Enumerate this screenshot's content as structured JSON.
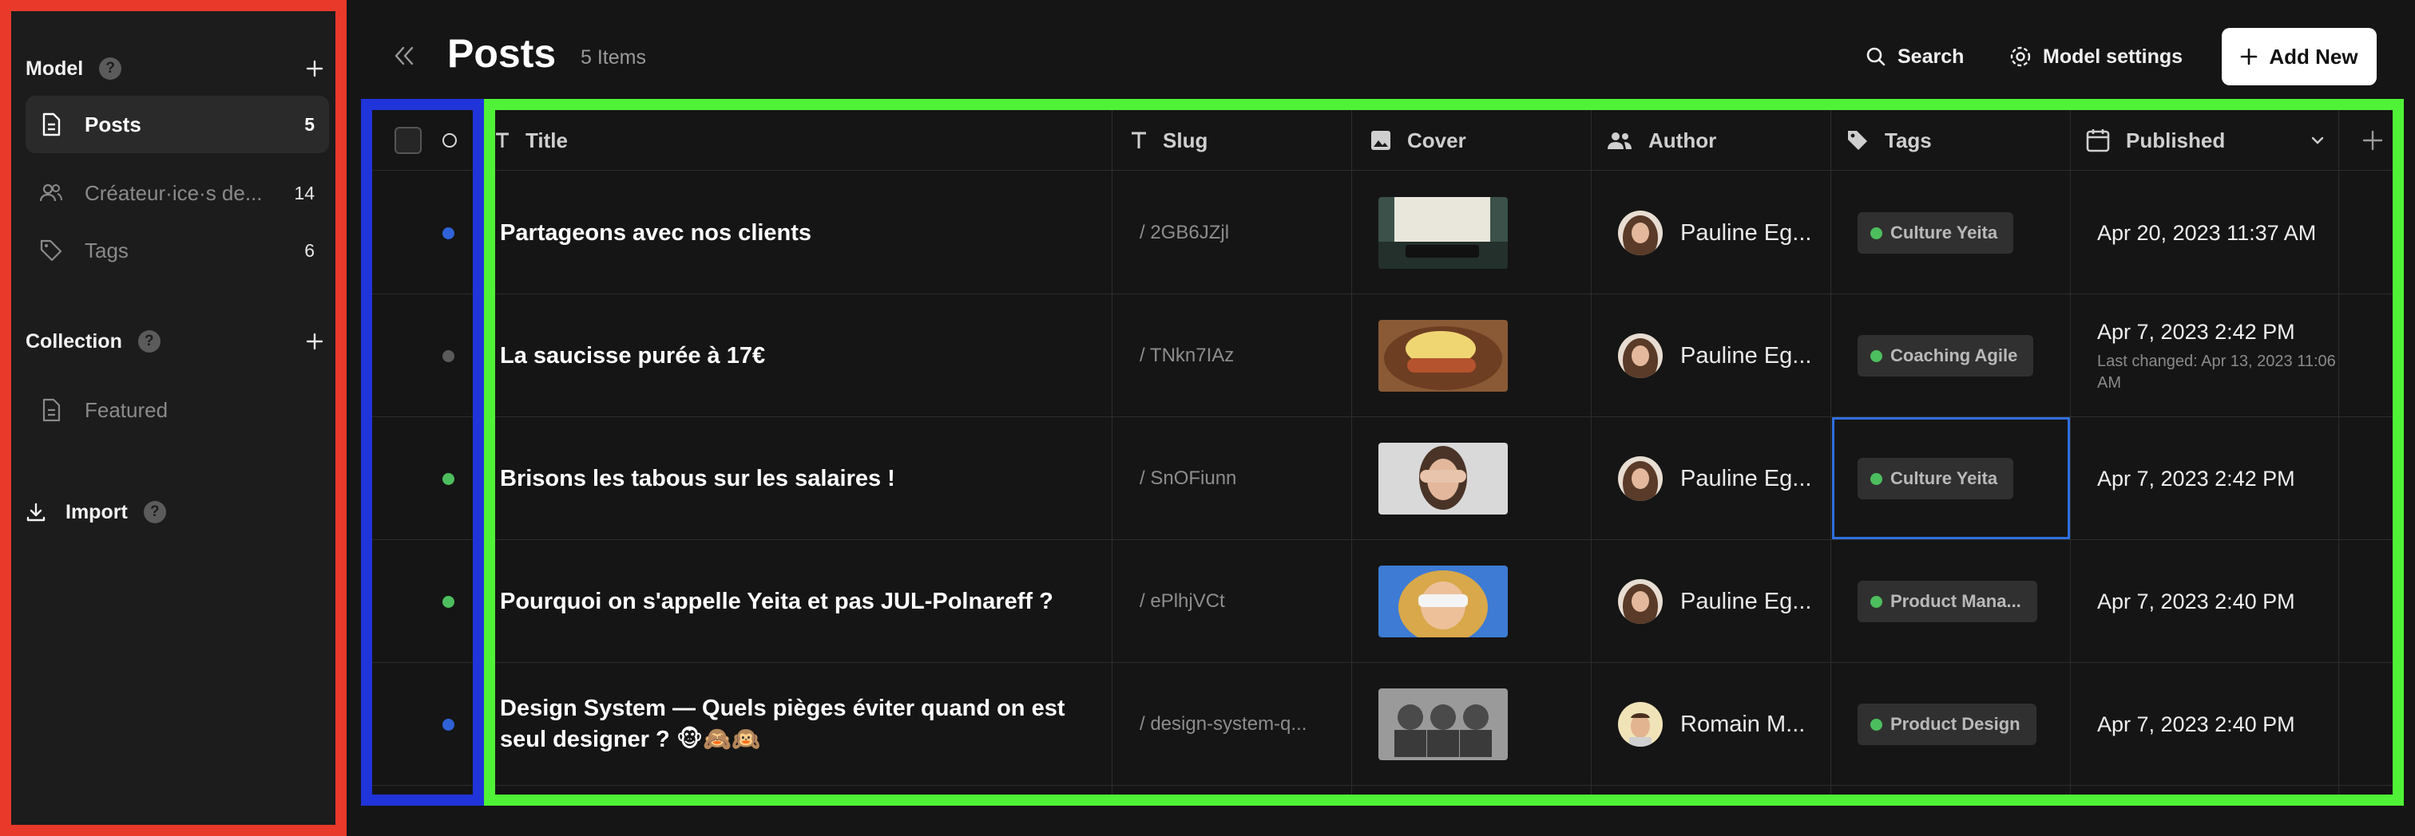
{
  "sidebar": {
    "model_label": "Model",
    "collection_label": "Collection",
    "import_label": "Import",
    "help_glyph": "?",
    "model_items": [
      {
        "label": "Posts",
        "count": "5",
        "icon": "document-icon"
      },
      {
        "label": "Créateur·ice·s de...",
        "count": "14",
        "icon": "users-icon"
      },
      {
        "label": "Tags",
        "count": "6",
        "icon": "tag-icon"
      }
    ],
    "collection_items": [
      {
        "label": "Featured",
        "icon": "document-icon"
      }
    ]
  },
  "header": {
    "title": "Posts",
    "count": "5 Items",
    "search_label": "Search",
    "settings_label": "Model settings",
    "add_label": "Add New"
  },
  "table": {
    "columns": [
      "Title",
      "Slug",
      "Cover",
      "Author",
      "Tags",
      "Published"
    ],
    "rows": [
      {
        "status_color": "#2f62d8",
        "title": "Partageons avec nos clients",
        "slug": "/ 2GB6JZjl",
        "author": "Pauline Eg...",
        "tag": "Culture Yeita",
        "published": "Apr 20, 2023 11:37 AM",
        "published_sub": ""
      },
      {
        "status_color": "#5a5a5a",
        "title": "La saucisse purée à 17€",
        "slug": "/ TNkn7IAz",
        "author": "Pauline Eg...",
        "tag": "Coaching Agile",
        "published": "Apr 7, 2023 2:42 PM",
        "published_sub": "Last changed: Apr 13, 2023 11:06 AM"
      },
      {
        "status_color": "#4dbe5e",
        "title": "Brisons les tabous sur les salaires !",
        "slug": "/ SnOFiunn",
        "author": "Pauline Eg...",
        "tag": "Culture Yeita",
        "published": "Apr 7, 2023 2:42 PM",
        "published_sub": ""
      },
      {
        "status_color": "#4dbe5e",
        "title": "Pourquoi on s'appelle Yeita et pas JUL-Polnareff ?",
        "slug": "/ ePlhjVCt",
        "author": "Pauline Eg...",
        "tag": "Product Mana...",
        "published": "Apr 7, 2023 2:40 PM",
        "published_sub": ""
      },
      {
        "status_color": "#2f62d8",
        "title": "Design System — Quels pièges éviter quand on est seul designer ? 🐵🙈🙉",
        "slug": "/ design-system-q...",
        "author": "Romain M...",
        "tag": "Product Design",
        "published": "Apr 7, 2023 2:40 PM",
        "published_sub": ""
      }
    ]
  },
  "colors": {
    "sidebar_outline": "#e8392a",
    "select_outline": "#1f34d9",
    "data_outline": "#4ff236",
    "tag_dot": "#4dbe5e",
    "focus": "#2f6fde"
  }
}
